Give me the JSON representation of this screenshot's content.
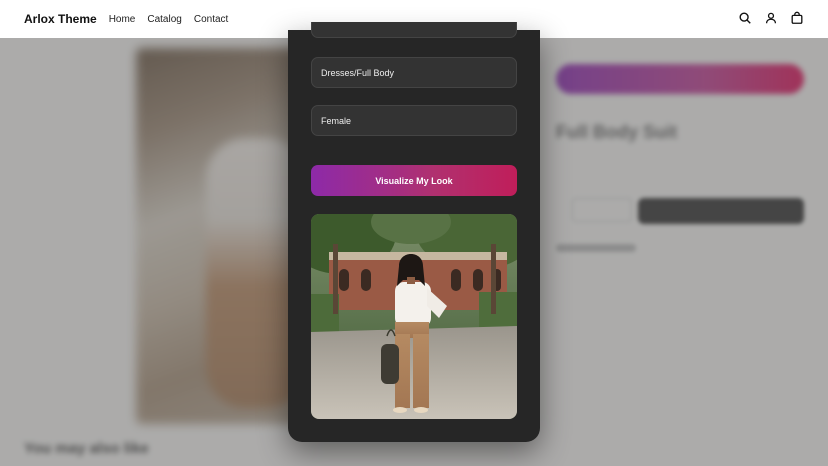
{
  "header": {
    "brand": "Arlox Theme",
    "nav": [
      "Home",
      "Catalog",
      "Contact"
    ],
    "icons": [
      "search-icon",
      "user-icon",
      "bag-icon"
    ]
  },
  "background_page": {
    "product_title": "Full Body Suit",
    "section_title": "You may also like"
  },
  "modal": {
    "category_value": "Dresses/Full Body",
    "gender_value": "Female",
    "visualize_label": "Visualize My Look",
    "result_image": "woman-walking-courtyard-photo"
  },
  "colors": {
    "modal_bg": "#262626",
    "field_bg": "#333333",
    "button_gradient_start": "#8d2aa8",
    "button_gradient_end": "#c01e5a"
  }
}
